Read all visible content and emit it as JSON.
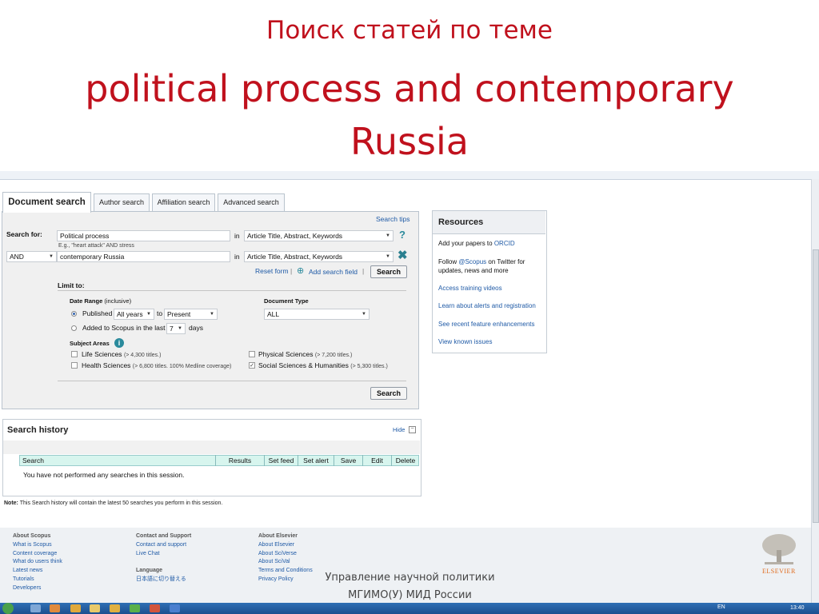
{
  "slide": {
    "title_line1": "Поиск статей по теме",
    "title_line2a": "political process and contemporary",
    "title_line2b": "Russia",
    "caption_line1": "Управление научной политики",
    "caption_line2": "МГИМО(У) МИД России"
  },
  "tabs": [
    {
      "label": "Document search",
      "active": true
    },
    {
      "label": "Author search"
    },
    {
      "label": "Affiliation search"
    },
    {
      "label": "Advanced search"
    }
  ],
  "search": {
    "tips_link": "Search tips",
    "search_for_label": "Search for:",
    "field1_value": "Political process",
    "example": "E.g., \"heart attack\" AND stress",
    "in_label": "in",
    "scope1": "Article Title, Abstract, Keywords",
    "operator": "AND",
    "field2_value": "contemporary Russia",
    "scope2": "Article Title, Abstract, Keywords",
    "reset_form": "Reset form",
    "separator": "|",
    "add_field": "Add search field",
    "search_button": "Search"
  },
  "limit": {
    "title": "Limit to:",
    "date_range_label": "Date Range",
    "date_range_hint": "(inclusive)",
    "published_label": "Published",
    "from_value": "All years",
    "to_label": "to",
    "to_value": "Present",
    "added_label": "Added to Scopus in the last",
    "days_value": "7",
    "days_label": "days",
    "doc_type_label": "Document Type",
    "doc_type_value": "ALL",
    "subject_areas_label": "Subject Areas",
    "subjects": [
      {
        "label": "Life Sciences",
        "detail": "(> 4,300 titles.)",
        "checked": false
      },
      {
        "label": "Physical Sciences",
        "detail": "(> 7,200 titles.)",
        "checked": false
      },
      {
        "label": "Health Sciences",
        "detail": "(> 6,800 titles. 100% Medline coverage)",
        "checked": false
      },
      {
        "label": "Social Sciences & Humanities",
        "detail": "(> 5,300 titles.)",
        "checked": true
      }
    ],
    "search_button": "Search"
  },
  "resources": {
    "title": "Resources",
    "items": [
      {
        "text": "Add your papers to ",
        "link": "ORCID"
      },
      {
        "text": "Follow ",
        "link": "@Scopus",
        "text2": " on Twitter for updates, news and more"
      },
      {
        "link": "Access training videos"
      },
      {
        "link": "Learn about alerts and registration"
      },
      {
        "link": "See recent feature enhancements"
      },
      {
        "link": "View known issues"
      }
    ]
  },
  "history": {
    "title": "Search history",
    "hide": "Hide",
    "columns": [
      "Search",
      "Results",
      "Set feed",
      "Set alert",
      "Save",
      "Edit",
      "Delete"
    ],
    "empty_message": "You have not performed any searches in this session.",
    "note_label": "Note:",
    "note_text": "This Search history will contain the latest 50 searches you perform in this session."
  },
  "footer": {
    "col1_title": "About Scopus",
    "col1_links": [
      "What is Scopus",
      "Content coverage",
      "What do users think",
      "Latest news",
      "Tutorials",
      "Developers"
    ],
    "col2_title": "Contact and Support",
    "col2_links": [
      "Contact and support",
      "Live Chat"
    ],
    "col2_lang_title": "Language",
    "col2_lang_link": "日本語に切り替える",
    "col3_title": "About Elsevier",
    "col3_links": [
      "About Elsevier",
      "About SciVerse",
      "About SciVal",
      "Terms and Conditions",
      "Privacy Policy"
    ],
    "logo_text": "ELSEVIER"
  },
  "taskbar": {
    "lang": "EN",
    "clock": "13:40"
  },
  "colors": {
    "title_red": "#c0111d",
    "link_blue": "#1f5aa6",
    "table_head": "#d7f5ee",
    "elsevier_orange": "#e06a1b"
  }
}
